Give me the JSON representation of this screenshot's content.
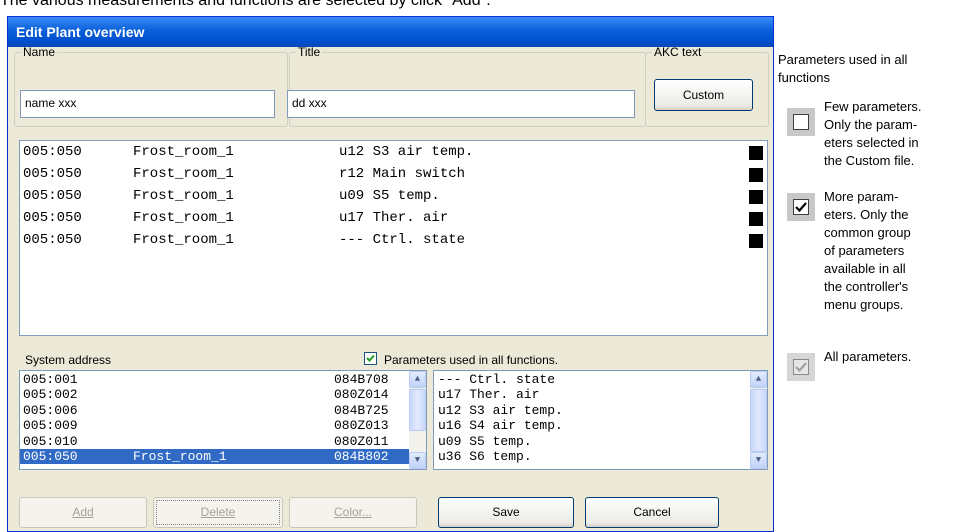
{
  "caption": "The various measurements and functions are selected by click \"Add\".",
  "window": {
    "title": "Edit Plant overview"
  },
  "name_group": {
    "label": "Name",
    "value": "name xxx"
  },
  "title_group": {
    "label": "Title",
    "value": "dd xxx"
  },
  "akc_group": {
    "label": "AKC text",
    "button": "Custom"
  },
  "plant_rows": [
    {
      "address": "005:050",
      "name": "Frost_room_1",
      "param": "u12 S3 air temp.",
      "color": "#000000"
    },
    {
      "address": "005:050",
      "name": "Frost_room_1",
      "param": "r12 Main switch",
      "color": "#000000"
    },
    {
      "address": "005:050",
      "name": "Frost_room_1",
      "param": "u09 S5 temp.",
      "color": "#000000"
    },
    {
      "address": "005:050",
      "name": "Frost_room_1",
      "param": "u17 Ther. air",
      "color": "#000000"
    },
    {
      "address": "005:050",
      "name": "Frost_room_1",
      "param": "--- Ctrl. state",
      "color": "#000000"
    }
  ],
  "system_address_label": "System address",
  "all_functions_checkbox": {
    "label": "Parameters used in all functions.",
    "checked": true
  },
  "system_list": [
    {
      "address": "005:001",
      "name": "",
      "code": "084B708",
      "selected": false
    },
    {
      "address": "005:002",
      "name": "",
      "code": "080Z014",
      "selected": false
    },
    {
      "address": "005:006",
      "name": "",
      "code": "084B725",
      "selected": false
    },
    {
      "address": "005:009",
      "name": "",
      "code": "080Z013",
      "selected": false
    },
    {
      "address": "005:010",
      "name": "",
      "code": "080Z011",
      "selected": false
    },
    {
      "address": "005:050",
      "name": "Frost_room_1",
      "code": "084B802",
      "selected": true
    }
  ],
  "param_list": [
    "--- Ctrl. state",
    "u17 Ther. air",
    "u12 S3 air temp.",
    "u16 S4 air temp.",
    "u09 S5 temp.",
    "u36 S6 temp."
  ],
  "buttons": {
    "add": "Add",
    "delete": "Delete",
    "color": "Color...",
    "save": "Save",
    "cancel": "Cancel"
  },
  "side_panel": {
    "heading_line1": "Parameters used in all",
    "heading_line2": "functions",
    "items": [
      {
        "state": "unchecked",
        "lines": [
          "Few parameters.",
          "Only the param-",
          "eters selected in",
          "the Custom file."
        ]
      },
      {
        "state": "checked",
        "lines": [
          "More param-",
          "eters. Only the",
          "common group",
          "of parameters",
          "available in all",
          "the controller's",
          "menu groups."
        ]
      },
      {
        "state": "grayed",
        "lines": [
          "All parameters."
        ]
      }
    ]
  }
}
